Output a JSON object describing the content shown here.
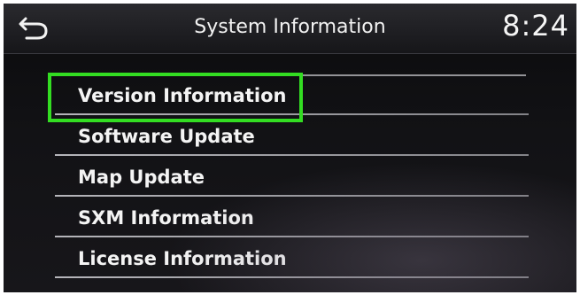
{
  "header": {
    "back_icon": "back-arrow-icon",
    "title": "System Information",
    "clock": "8:24"
  },
  "menu": {
    "items": [
      {
        "label": "Version Information",
        "selected": true
      },
      {
        "label": "Software Update"
      },
      {
        "label": "Map Update"
      },
      {
        "label": "SXM Information"
      },
      {
        "label": "License Information"
      }
    ],
    "highlight_color": "#33dd22"
  }
}
